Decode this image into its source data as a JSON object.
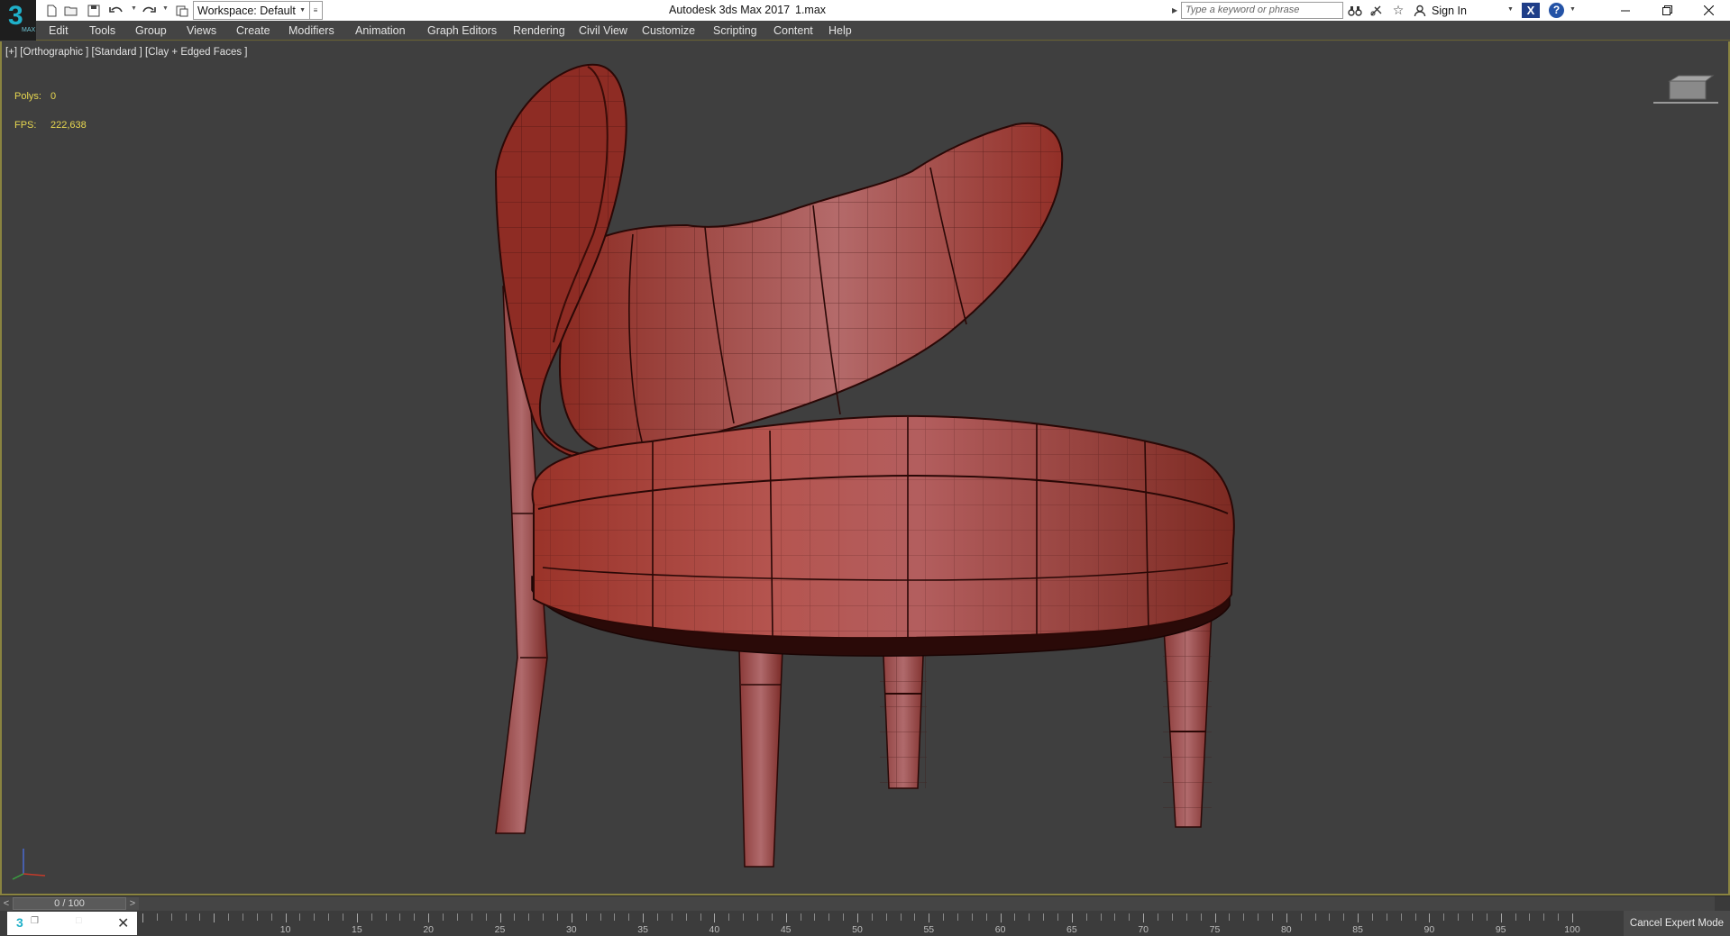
{
  "titlebar": {
    "workspace_label": "Workspace: Default",
    "app_title": "Autodesk 3ds Max 2017",
    "file_name": "1.max",
    "search_placeholder": "Type a keyword or phrase",
    "sign_in": "Sign In",
    "logo_digit": "3",
    "logo_small": "MAX",
    "icons": [
      "new-file-icon",
      "open-file-icon",
      "save-icon",
      "undo-icon",
      "redo-icon",
      "project-folder-icon",
      "binoculars-icon",
      "satellite-icon",
      "star-icon",
      "user-icon",
      "exchange-icon",
      "help-icon"
    ]
  },
  "menu": {
    "items": [
      "Edit",
      "Tools",
      "Group",
      "Views",
      "Create",
      "Modifiers",
      "Animation",
      "Graph Editors",
      "Rendering",
      "Civil View",
      "Customize",
      "Scripting",
      "Content",
      "Help"
    ]
  },
  "viewport": {
    "label": "[+] [Orthographic ] [Standard ] [Clay + Edged Faces ]",
    "stats": {
      "polys_label": "Polys:",
      "polys_value": "0",
      "fps_label": "FPS:",
      "fps_value": "222,638"
    },
    "model_color": "#a84038",
    "background_color": "#3f3f3f"
  },
  "timeslider": {
    "position": "0 / 100",
    "prev": "<",
    "next": ">"
  },
  "trackbar": {
    "ticks": [
      "10",
      "15",
      "20",
      "25",
      "30",
      "35",
      "40",
      "45",
      "50",
      "55",
      "60",
      "65",
      "70",
      "75",
      "80",
      "85",
      "90",
      "95",
      "100"
    ],
    "expert_mode_button": "Cancel Expert Mode"
  }
}
